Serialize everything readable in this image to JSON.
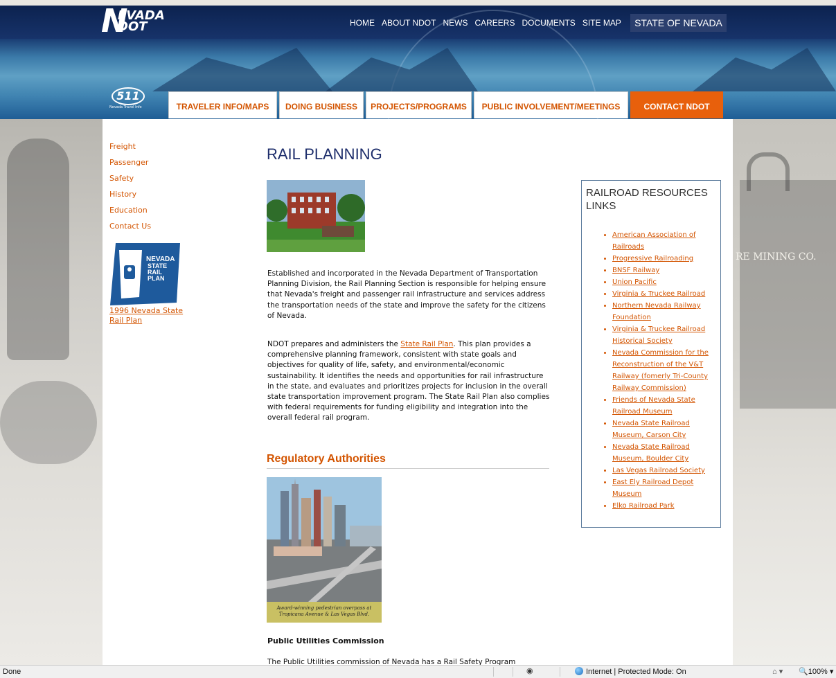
{
  "logo": {
    "line1": "EVADA",
    "line2": "DOT",
    "letter": "N"
  },
  "top_nav": [
    "HOME",
    "ABOUT NDOT",
    "NEWS",
    "CAREERS",
    "DOCUMENTS",
    "SITE MAP"
  ],
  "state_label": "STATE OF NEVADA",
  "logo_511": {
    "number": "511",
    "tagline": "Nevada Travel Info"
  },
  "main_nav": [
    "TRAVELER INFO/MAPS",
    "DOING BUSINESS",
    "PROJECTS/PROGRAMS",
    "PUBLIC INVOLVEMENT/MEETINGS",
    "CONTACT NDOT"
  ],
  "left_nav": [
    "Freight",
    "Passenger",
    "Safety",
    "History",
    "Education",
    "Contact Us"
  ],
  "rail_plan_badge": {
    "line1": "NEVADA",
    "line2": "STATE",
    "line3": "RAIL",
    "line4": "PLAN"
  },
  "rail_plan_link": "1996 Nevada State Rail Plan",
  "page_title": "RAIL PLANNING",
  "intro_paragraph": "Established and incorporated in the Nevada Department of Transportation Planning Division, the Rail Planning Section is responsible for helping ensure that Nevada's freight and passenger rail infrastructure and services address the transportation needs of the state and improve the safety for the citizens of Nevada.",
  "plan_paragraph": {
    "before": "NDOT prepares and administers the ",
    "link": "State Rail Plan",
    "after": ". This plan provides a comprehensive planning framework, consistent with state goals and objectives for quality of life, safety, and environmental/economic sustainability. It identifies the needs and opportunities for rail infrastructure in the state, and evaluates and prioritizes projects for inclusion in the overall state transportation improvement program. The State Rail Plan also complies with federal requirements for funding eligibility and integration into the overall federal rail program."
  },
  "regulatory_heading": "Regulatory Authorities",
  "photo_caption": {
    "line1": "Award-winning pedestrian overpass at",
    "line2": "Tropicana Avenue & Las Vegas Blvd."
  },
  "puc_heading": "Public Utilities Commission",
  "puc_partial": "The Public Utilities commission of Nevada has a Rail Safety Program",
  "resources": {
    "title": "RAILROAD RESOURCES LINKS",
    "links": [
      "American Association of Railroads",
      "Progressive Railroading",
      "BNSF Railway",
      "Union Pacific",
      "Virginia & Truckee Railroad",
      "Northern Nevada Railway Foundation",
      "Virginia & Truckee Railroad Historical Society",
      "Nevada Commission for the Reconstruction of the V&T Railway (fomerly Tri-County Railway Commission)",
      "Friends of Nevada State Railroad Museum",
      "Nevada State Railroad Museum, Carson City",
      "Nevada State Railroad Museum, Boulder City",
      "Las Vegas Railroad Society",
      "East Ely Railroad Depot Museum",
      "Elko Railroad Park"
    ]
  },
  "background_sign": "RE MINING CO.",
  "status_bar": {
    "status": "Done",
    "zone": "Internet | Protected Mode: On",
    "zoom": "100%"
  },
  "colors": {
    "accent": "#d35400",
    "title_blue": "#1d2d6b",
    "contact_tab": "#e8600c",
    "header_dark": "#0f2a5c"
  }
}
